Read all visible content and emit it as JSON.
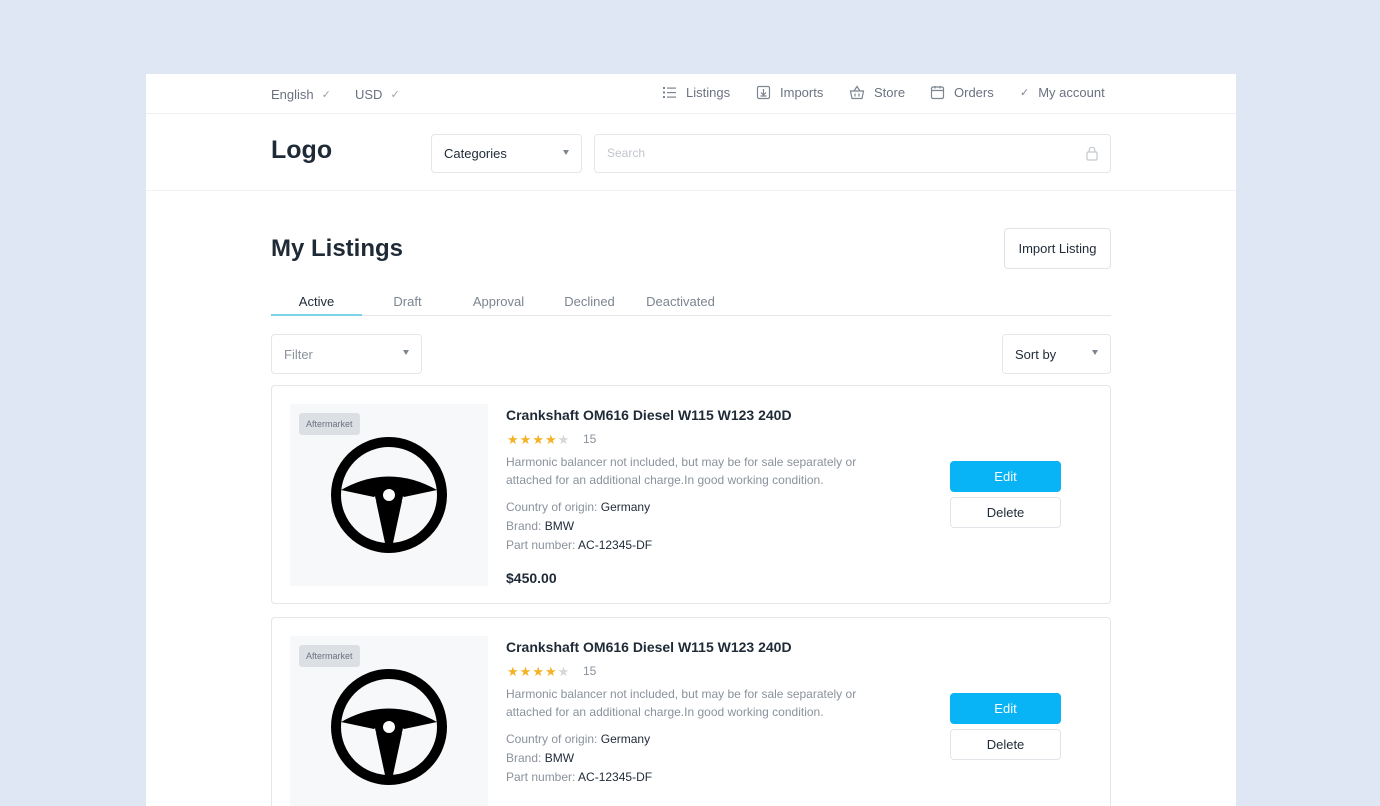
{
  "topbar": {
    "language": "English",
    "currency": "USD",
    "nav": [
      {
        "label": "Listings",
        "icon": "list-icon"
      },
      {
        "label": "Imports",
        "icon": "import-icon"
      },
      {
        "label": "Store",
        "icon": "basket-icon"
      },
      {
        "label": "Orders",
        "icon": "calendar-icon"
      },
      {
        "label": "My account",
        "icon": "check-icon"
      }
    ]
  },
  "header": {
    "logo": "Logo",
    "categories_label": "Categories",
    "search_placeholder": "Search"
  },
  "main": {
    "title": "My Listings",
    "import_button": "Import Listing",
    "tabs": [
      {
        "label": "Active",
        "active": true
      },
      {
        "label": "Draft",
        "active": false
      },
      {
        "label": "Approval",
        "active": false
      },
      {
        "label": "Declined",
        "active": false
      },
      {
        "label": "Deactivated",
        "active": false
      }
    ],
    "filter_label": "Filter",
    "sort_label": "Sort by"
  },
  "listings": [
    {
      "badge": "Aftermarket",
      "image_icon": "steering-wheel-icon",
      "name": "Crankshaft OM616 Diesel W115 W123 240D",
      "rating": 4,
      "rating_max": 5,
      "reviews": "15",
      "description": "Harmonic balancer not included, but may be for sale separately or attached for an additional charge.In good working condition.",
      "origin_label": "Country of origin:",
      "origin_value": "Germany",
      "brand_label": "Brand:",
      "brand_value": "BMW",
      "part_label": "Part number:",
      "part_value": "AC-12345-DF",
      "price": "$450.00",
      "edit_label": "Edit",
      "delete_label": "Delete"
    },
    {
      "badge": "Aftermarket",
      "image_icon": "steering-wheel-icon",
      "name": "Crankshaft OM616 Diesel W115 W123 240D",
      "rating": 4,
      "rating_max": 5,
      "reviews": "15",
      "description": "Harmonic balancer not included, but may be for sale separately or attached for an additional charge.In good working condition.",
      "origin_label": "Country of origin:",
      "origin_value": "Germany",
      "brand_label": "Brand:",
      "brand_value": "BMW",
      "part_label": "Part number:",
      "part_value": "AC-12345-DF",
      "edit_label": "Edit",
      "delete_label": "Delete"
    }
  ],
  "colors": {
    "background": "#dfe6f4",
    "accent": "#08b4f6",
    "star": "#f5b323",
    "tab_indicator": "#7dd3e6",
    "text_dark": "#1f2a37"
  }
}
